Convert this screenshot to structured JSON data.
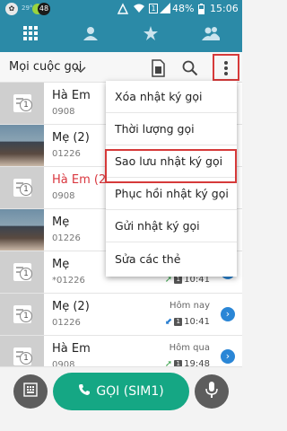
{
  "status": {
    "left_badge": "48",
    "temp": "29°",
    "sim_indicator": "1",
    "battery": "48%",
    "time": "15:06"
  },
  "tabs": [
    "dialpad-grid-icon",
    "contacts-person-icon",
    "favorites-star-icon",
    "groups-people-icon"
  ],
  "header": {
    "title": "Mọi cuộc gọi"
  },
  "calls": [
    {
      "name": "Hà Em",
      "number": "0908",
      "when": "",
      "time": "",
      "missed": false,
      "avatar": "placeholder"
    },
    {
      "name": "Mẹ (2)",
      "number": "01226",
      "when": "",
      "time": "",
      "missed": false,
      "avatar": "photo"
    },
    {
      "name": "Hà Em (2)",
      "number": "0908",
      "when": "",
      "time": "",
      "missed": true,
      "avatar": "placeholder"
    },
    {
      "name": "Mẹ",
      "number": "01226",
      "when": "",
      "time": "",
      "missed": false,
      "avatar": "photo"
    },
    {
      "name": "Mẹ",
      "number": "*01226",
      "when": "",
      "time": "10:41",
      "missed": false,
      "avatar": "placeholder"
    },
    {
      "name": "Mẹ (2)",
      "number": "01226",
      "when": "Hôm nay",
      "time": "10:41",
      "missed": false,
      "avatar": "placeholder"
    },
    {
      "name": "Hà Em",
      "number": "0908",
      "when": "Hôm qua",
      "time": "19:48",
      "missed": false,
      "avatar": "placeholder"
    }
  ],
  "menu": [
    "Xóa nhật ký gọi",
    "Thời lượng gọi",
    "Sao lưu nhật ký gọi",
    "Phục hồi nhật ký gọi",
    "Gửi nhật ký gọi",
    "Sửa các thẻ"
  ],
  "bottom": {
    "call_label": "GỌI (SIM1)"
  },
  "colors": {
    "accent": "#2b8aa7",
    "call_button": "#15a784",
    "highlight": "#d63a3a",
    "missed": "#d9363e"
  }
}
